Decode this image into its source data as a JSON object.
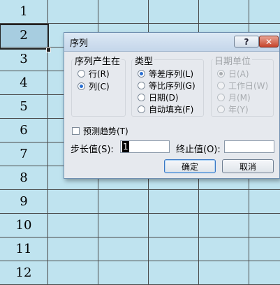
{
  "sheet": {
    "rows": [
      "1",
      "2",
      "3",
      "4",
      "5",
      "6",
      "7",
      "8",
      "9",
      "10",
      "11",
      "12"
    ],
    "selected_row": "2"
  },
  "dialog": {
    "title": "序列",
    "help_label": "?",
    "close_label": "✕",
    "series_in": {
      "label": "序列产生在",
      "options": [
        "行(R)",
        "列(C)"
      ],
      "selected": "列(C)"
    },
    "type": {
      "label": "类型",
      "options": [
        "等差序列(L)",
        "等比序列(G)",
        "日期(D)",
        "自动填充(F)"
      ],
      "selected": "等差序列(L)"
    },
    "date_unit": {
      "label": "日期单位",
      "options": [
        "日(A)",
        "工作日(W)",
        "月(M)",
        "年(Y)"
      ],
      "selected": "日(A)",
      "enabled": false
    },
    "trend_label": "预测趋势(T)",
    "step_label": "步长值(S):",
    "step_value": "1",
    "stop_label": "终止值(O):",
    "stop_value": "",
    "ok_label": "确定",
    "cancel_label": "取消"
  },
  "colors": {
    "cell_bg": "#bfe3ef",
    "grid_line": "#4a4a4a",
    "dialog_bg": "#e6e9ee",
    "accent": "#2a6fd1"
  }
}
